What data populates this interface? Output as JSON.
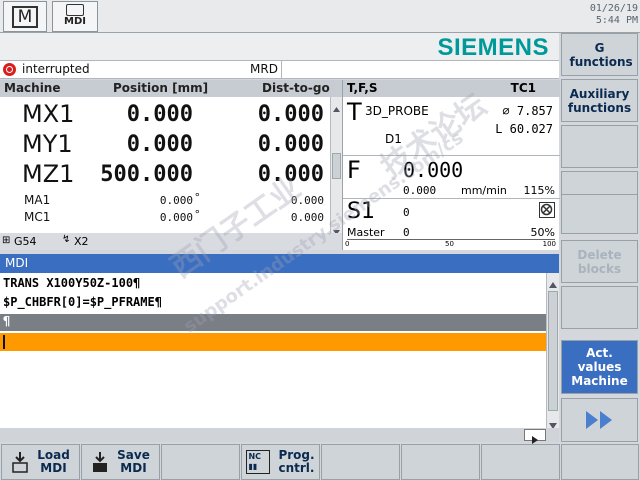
{
  "header": {
    "mode_m_label": "M",
    "mode_mdi_label": "MDI",
    "date": "01/26/19",
    "time": "5:44 PM"
  },
  "brand": "SIEMENS",
  "status": {
    "text": "interrupted",
    "mode": "MRD"
  },
  "machine": {
    "col_machine": "Machine",
    "col_position": "Position [mm]",
    "col_dist": "Dist-to-go",
    "axes": [
      {
        "name": "MX1",
        "pos": "0.000",
        "dist": "0.000"
      },
      {
        "name": "MY1",
        "pos": "0.000",
        "dist": "0.000"
      },
      {
        "name": "MZ1",
        "pos": "500.000",
        "dist": "0.000"
      }
    ],
    "rot_axes": [
      {
        "name": "MA1",
        "pos": "0.000",
        "unit": "°",
        "dist": "0.000"
      },
      {
        "name": "MC1",
        "pos": "0.000",
        "unit": "°",
        "dist": "0.000"
      }
    ],
    "wcs": "G54",
    "wcs2": "X2"
  },
  "tool": {
    "header": "T,F,S",
    "channel": "TC1",
    "t_label": "T",
    "tool_name": "3D_PROBE",
    "diameter": "⌀ 7.857",
    "length": "L 60.027",
    "d_number": "D1",
    "f_label": "F",
    "feed_value": "0.000",
    "feed_actual": "0.000",
    "feed_unit": "mm/min",
    "feed_override": "115%",
    "s_label": "S1",
    "spindle_value": "0",
    "master_label": "Master",
    "master_value": "0",
    "spindle_override": "50%",
    "scale_0": "0",
    "scale_50": "50",
    "scale_100": "100",
    "spindle_load_fraction": 0
  },
  "mdi": {
    "title": "MDI",
    "lines": [
      "TRANS X100Y50Z-100¶",
      "$P_CHBFR[0]=$P_PFRAME¶",
      "¶",
      ""
    ]
  },
  "softkeys_right": [
    "G functions",
    "Auxiliary functions",
    "",
    "",
    "",
    "Delete blocks",
    "",
    "Act. values Machine",
    ""
  ],
  "softkeys_bottom": [
    {
      "line1": "Load",
      "line2": "MDI"
    },
    {
      "line1": "Save",
      "line2": "MDI"
    },
    {
      "line1": "",
      "line2": ""
    },
    {
      "line1": "Prog.",
      "line2": "cntrl."
    },
    {
      "line1": "",
      "line2": ""
    },
    {
      "line1": "",
      "line2": ""
    },
    {
      "line1": "",
      "line2": ""
    }
  ],
  "watermark": [
    "西门子工业",
    "support.industry.siemens.com/cs",
    "技术论坛"
  ],
  "colors": {
    "brand": "#009999",
    "highlight_row": "#ff9900",
    "active_softkey": "#3a6ec0",
    "status_icon": "#d81e1e"
  }
}
